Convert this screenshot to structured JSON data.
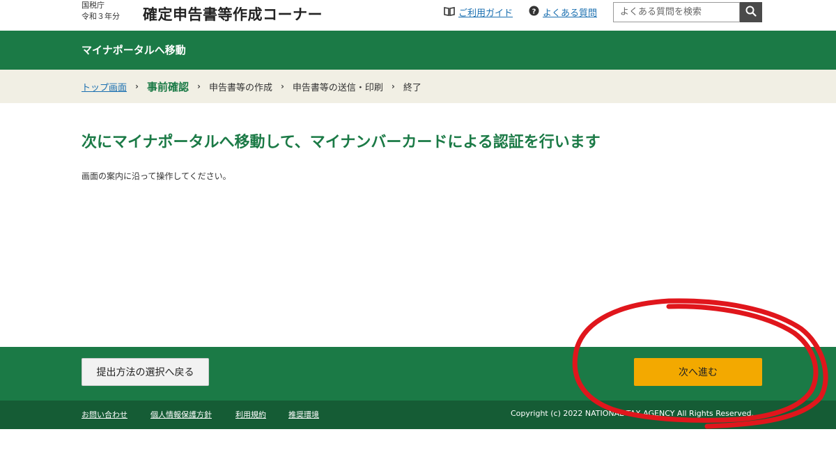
{
  "header": {
    "agency": "国税庁",
    "year": "令和３年分",
    "site_title": "確定申告書等作成コーナー",
    "guide_label": "ご利用ガイド",
    "faq_label": "よくある質問",
    "search_placeholder": "よくある質問を検索"
  },
  "banner": {
    "title": "マイナポータルへ移動"
  },
  "breadcrumb": {
    "top": "トップ画面",
    "current": "事前確認",
    "step_create": "申告書等の作成",
    "step_send": "申告書等の送信・印刷",
    "step_end": "終了",
    "separator": "›"
  },
  "main": {
    "heading": "次にマイナポータルへ移動して、マイナンバーカードによる認証を行います",
    "text": "画面の案内に沿って操作してください。"
  },
  "actions": {
    "back_label": "提出方法の選択へ戻る",
    "next_label": "次へ進む"
  },
  "footer": {
    "links": [
      "お問い合わせ",
      "個人情報保護方針",
      "利用規約",
      "推奨環境"
    ],
    "copyright": "Copyright (c) 2022 NATIONAL TAX AGENCY All Rights Reserved."
  },
  "colors": {
    "brand_green": "#1b7a46",
    "footer_green": "#155c35",
    "next_button": "#f3a900",
    "annotation_red": "#e0161c"
  },
  "icons": [
    "book-icon",
    "question-icon",
    "search-icon"
  ]
}
